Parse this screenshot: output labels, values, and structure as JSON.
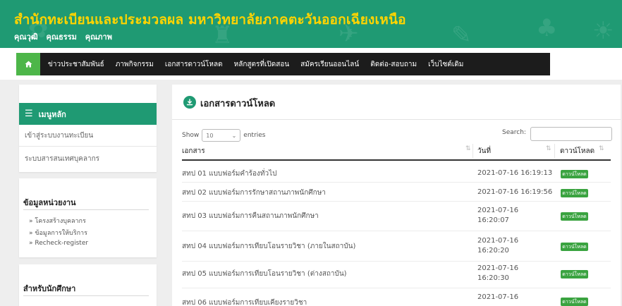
{
  "banner": {
    "title": "สำนักทะเบียนและประมวลผล มหาวิทยาลัยภาคตะวันออกเฉียงเหนือ",
    "motto": [
      "คุณวุฒิ",
      "คุณธรรม",
      "คุณภาพ"
    ]
  },
  "nav": {
    "home_icon": "home-icon",
    "items": [
      "ข่าวประชาสัมพันธ์",
      "ภาพกิจกรรม",
      "เอกสารดาวน์โหลด",
      "หลักสูตรที่เปิดสอน",
      "สมัครเรียนออนไลน์",
      "ติดต่อ-สอบถาม",
      "เว็บไซต์เดิม"
    ]
  },
  "sidebar": {
    "menu_title": "เมนูหลัก",
    "menu_links": [
      "เข้าสู่ระบบงานทะเบียน",
      "ระบบสารสนเทศบุคลากร"
    ],
    "unit_title": "ข้อมูลหน่วยงาน",
    "unit_links": [
      "» โครงสร้างบุคลากร",
      "» ข้อมูลการให้บริการ",
      "» Recheck-register"
    ],
    "student_title": "สำหรับนักศึกษา"
  },
  "main": {
    "title": "เอกสารดาวน์โหลด",
    "show_label": "Show",
    "page_size": "10",
    "entries_label": "entries",
    "search_label": "Search:",
    "columns": [
      "เอกสาร",
      "วันที่",
      "ดาวน์โหลด"
    ],
    "rows": [
      {
        "doc": "สทป 01 แบบฟอร์มคำร้องทั่วไป",
        "date": "2021-07-16 16:19:13",
        "action": "ดาวน์โหลด"
      },
      {
        "doc": "สทป 02 แบบฟอร์มการรักษาสถานภาพนักศึกษา",
        "date": "2021-07-16 16:19:56",
        "action": "ดาวน์โหลด"
      },
      {
        "doc": "สทป 03 แบบฟอร์มการคืนสถานภาพนักศึกษา",
        "date": "2021-07-16 16:20:07",
        "action": "ดาวน์โหลด"
      },
      {
        "doc": "สทป 04 แบบฟอร์มการเทียบโอนรายวิชา (ภายในสถาบัน)",
        "date": "2021-07-16 16:20:20",
        "action": "ดาวน์โหลด"
      },
      {
        "doc": "สทป 05 แบบฟอร์มการเทียบโอนรายวิชา (ต่างสถาบัน)",
        "date": "2021-07-16 16:20:30",
        "action": "ดาวน์โหลด"
      },
      {
        "doc": "สทป 06 แบบฟอร์มการเทียบเคียงรายวิชา",
        "date": "2021-07-16",
        "action": "ดาวน์โหลด"
      }
    ]
  },
  "colors": {
    "brand_green": "#1f9a73",
    "title_yellow": "#ffd400",
    "nav_dark": "#1c1c1c",
    "home_green": "#4db649",
    "badge_green": "#3aa340"
  }
}
